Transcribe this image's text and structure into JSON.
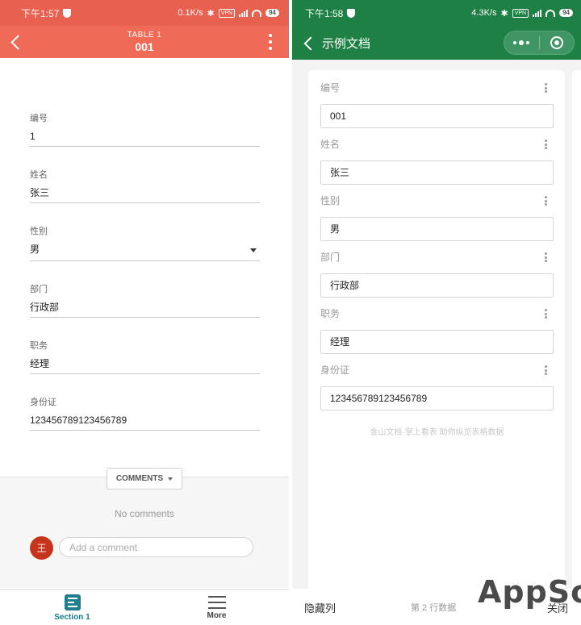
{
  "left": {
    "status": {
      "time": "下午1:57",
      "speed": "0.1K/s",
      "vpn": "VPN",
      "battery": "94"
    },
    "header": {
      "subtitle": "TABLE 1",
      "title": "001"
    },
    "fields": [
      {
        "label": "编号",
        "value": "1"
      },
      {
        "label": "姓名",
        "value": "张三"
      },
      {
        "label": "性别",
        "value": "男"
      },
      {
        "label": "部门",
        "value": "行政部"
      },
      {
        "label": "职务",
        "value": "经理"
      },
      {
        "label": "身份证",
        "value": "123456789123456789"
      }
    ],
    "comments": {
      "button_label": "COMMENTS",
      "empty_text": "No comments",
      "avatar_initial": "王",
      "input_placeholder": "Add a comment"
    },
    "bottom_nav": {
      "section_label": "Section 1",
      "more_label": "More"
    }
  },
  "right": {
    "status": {
      "time": "下午1:58",
      "speed": "4.3K/s",
      "vpn": "VPN",
      "battery": "94"
    },
    "header": {
      "title": "示例文档"
    },
    "fields": [
      {
        "label": "编号",
        "value": "001"
      },
      {
        "label": "姓名",
        "value": "张三"
      },
      {
        "label": "性别",
        "value": "男"
      },
      {
        "label": "部门",
        "value": "行政部"
      },
      {
        "label": "职务",
        "value": "经理"
      },
      {
        "label": "身份证",
        "value": "123456789123456789"
      }
    ],
    "footer_note": "金山文档·掌上看表 助你纵览表格数据",
    "bottom_bar": {
      "hide_columns": "隐藏列",
      "row_indicator": "第 2 行数据",
      "close": "关闭"
    }
  },
  "watermark": "AppSo",
  "colors": {
    "left_header": "#ef6b58",
    "left_status": "#e86050",
    "right_header": "#1f8045",
    "section_accent": "#1f7f8f",
    "avatar": "#c7341c"
  }
}
